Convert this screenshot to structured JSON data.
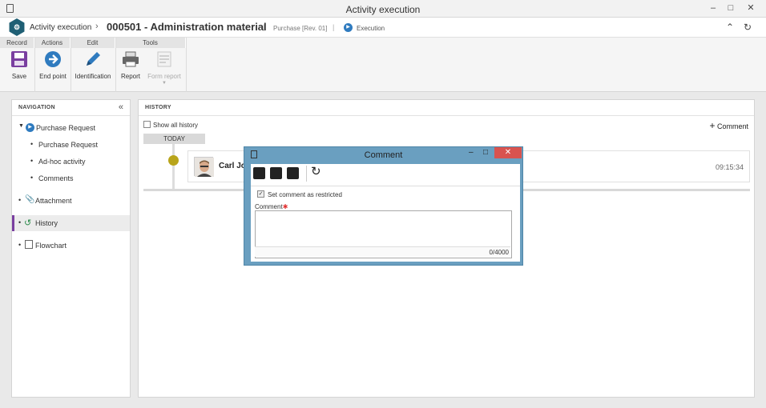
{
  "window": {
    "title": "Activity execution"
  },
  "header": {
    "breadcrumb_root": "Activity execution",
    "record_title": "000501 - Administration material",
    "process": "Purchase [Rev. 01]",
    "status": "Execution"
  },
  "ribbon": {
    "groups": [
      "Record",
      "Actions",
      "Edit",
      "Tools"
    ],
    "buttons": {
      "save": "Save",
      "end_point": "End point",
      "identification": "Identification",
      "report": "Report",
      "form_report": "Form report"
    }
  },
  "navigation": {
    "heading": "NAVIGATION",
    "items": [
      {
        "label": "Purchase Request"
      },
      {
        "label": "Purchase Request"
      },
      {
        "label": "Ad-hoc activity"
      },
      {
        "label": "Comments"
      },
      {
        "label": "Attachment"
      },
      {
        "label": "History"
      },
      {
        "label": "Flowchart"
      }
    ]
  },
  "history": {
    "heading": "HISTORY",
    "show_all_label": "Show all history",
    "add_comment_label": "Comment",
    "day_label": "TODAY",
    "entry": {
      "user": "Carl Jo",
      "time": "09:15:34"
    }
  },
  "comment_dialog": {
    "title": "Comment",
    "restricted_label": "Set comment as restricted",
    "restricted_checked": true,
    "field_label": "Comment",
    "value": "",
    "counter": "0/4000"
  },
  "colors": {
    "dialog_frame": "#6a9fc0",
    "close_button": "#d9534f",
    "active_nav_marker": "#7a3fa0",
    "timeline_dot": "#b8a41a",
    "execution_icon": "#2f7bbf"
  }
}
